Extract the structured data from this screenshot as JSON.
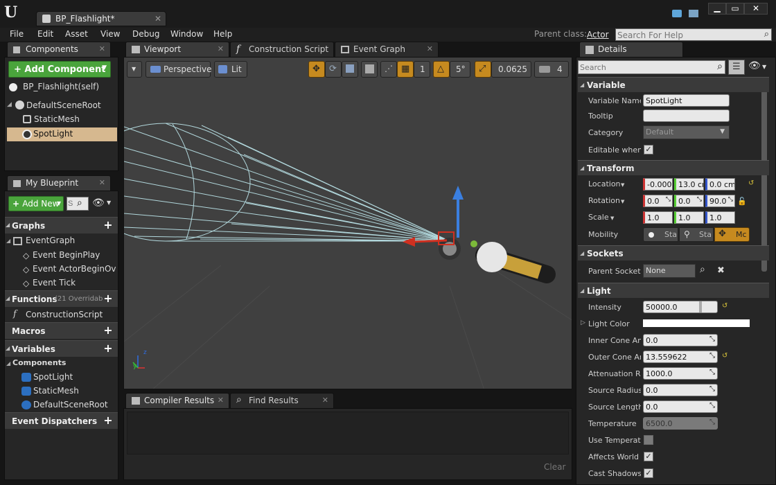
{
  "window": {
    "tab_title": "BP_Flashlight*"
  },
  "menu": [
    "File",
    "Edit",
    "Asset",
    "View",
    "Debug",
    "Window",
    "Help"
  ],
  "parent_class": {
    "label": "Parent class:",
    "value": "Actor"
  },
  "search_help": {
    "placeholder": "Search For Help"
  },
  "components_panel": {
    "tab": "Components",
    "add_button": "Add Component",
    "self_item": "BP_Flashlight(self)",
    "tree": [
      "DefaultSceneRoot",
      "StaticMesh",
      "SpotLight"
    ]
  },
  "viewport_tabs": [
    "Viewport",
    "Construction Script",
    "Event Graph"
  ],
  "viewport_toolbar": {
    "perspective": "Perspective",
    "lit": "Lit",
    "grid_snap": "1",
    "rot_snap": "5°",
    "scale_snap": "0.0625",
    "cam_speed": "4"
  },
  "my_blueprint": {
    "tab": "My Blueprint",
    "add_new": "Add New",
    "search_placeholder": "S",
    "graphs_header": "Graphs",
    "graph_items": [
      "EventGraph",
      "Event BeginPlay",
      "Event ActorBeginOv",
      "Event Tick"
    ],
    "functions_header": "Functions",
    "functions_overridable": "(21 Overridab",
    "function_items": [
      "ConstructionScript"
    ],
    "macros_header": "Macros",
    "variables_header": "Variables",
    "components_header": "Components",
    "component_items": [
      "SpotLight",
      "StaticMesh",
      "DefaultSceneRoot"
    ],
    "dispatchers_header": "Event Dispatchers"
  },
  "bottom_tabs": [
    "Compiler Results",
    "Find Results"
  ],
  "clear_label": "Clear",
  "details": {
    "tab": "Details",
    "search_placeholder": "Search",
    "variable_header": "Variable",
    "variable_name_label": "Variable Name",
    "variable_name_value": "SpotLight",
    "tooltip_label": "Tooltip",
    "tooltip_value": "",
    "category_label": "Category",
    "category_value": "Default",
    "editable_label": "Editable when",
    "transform_header": "Transform",
    "location_label": "Location",
    "location": [
      "-0.0000",
      "13.0 cm",
      "0.0 cm"
    ],
    "rotation_label": "Rotation",
    "rotation": [
      "0.0",
      "0.0",
      "90.0"
    ],
    "scale_label": "Scale",
    "scale": [
      "1.0",
      "1.0",
      "1.0"
    ],
    "mobility_label": "Mobility",
    "mobility": [
      "Sta",
      "Sta",
      "Mc"
    ],
    "sockets_header": "Sockets",
    "parent_socket_label": "Parent Socket",
    "parent_socket_value": "None",
    "light_header": "Light",
    "intensity_label": "Intensity",
    "intensity": "50000.0",
    "light_color_label": "Light Color",
    "light_color": "#ffffff",
    "inner_cone_label": "Inner Cone Ang",
    "inner_cone": "0.0",
    "outer_cone_label": "Outer Cone An",
    "outer_cone": "13.559622",
    "attenuation_label": "Attenuation Ra",
    "attenuation": "1000.0",
    "source_radius_label": "Source Radius",
    "source_radius": "0.0",
    "source_length_label": "Source Length",
    "source_length": "0.0",
    "temperature_label": "Temperature",
    "temperature": "6500.0",
    "use_temperature_label": "Use Temperatu",
    "affects_world_label": "Affects World",
    "cast_shadows_label": "Cast Shadows"
  },
  "colors": {
    "accent": "#4aa43c",
    "selection": "#d6b88f",
    "orange": "#c68a1f"
  }
}
